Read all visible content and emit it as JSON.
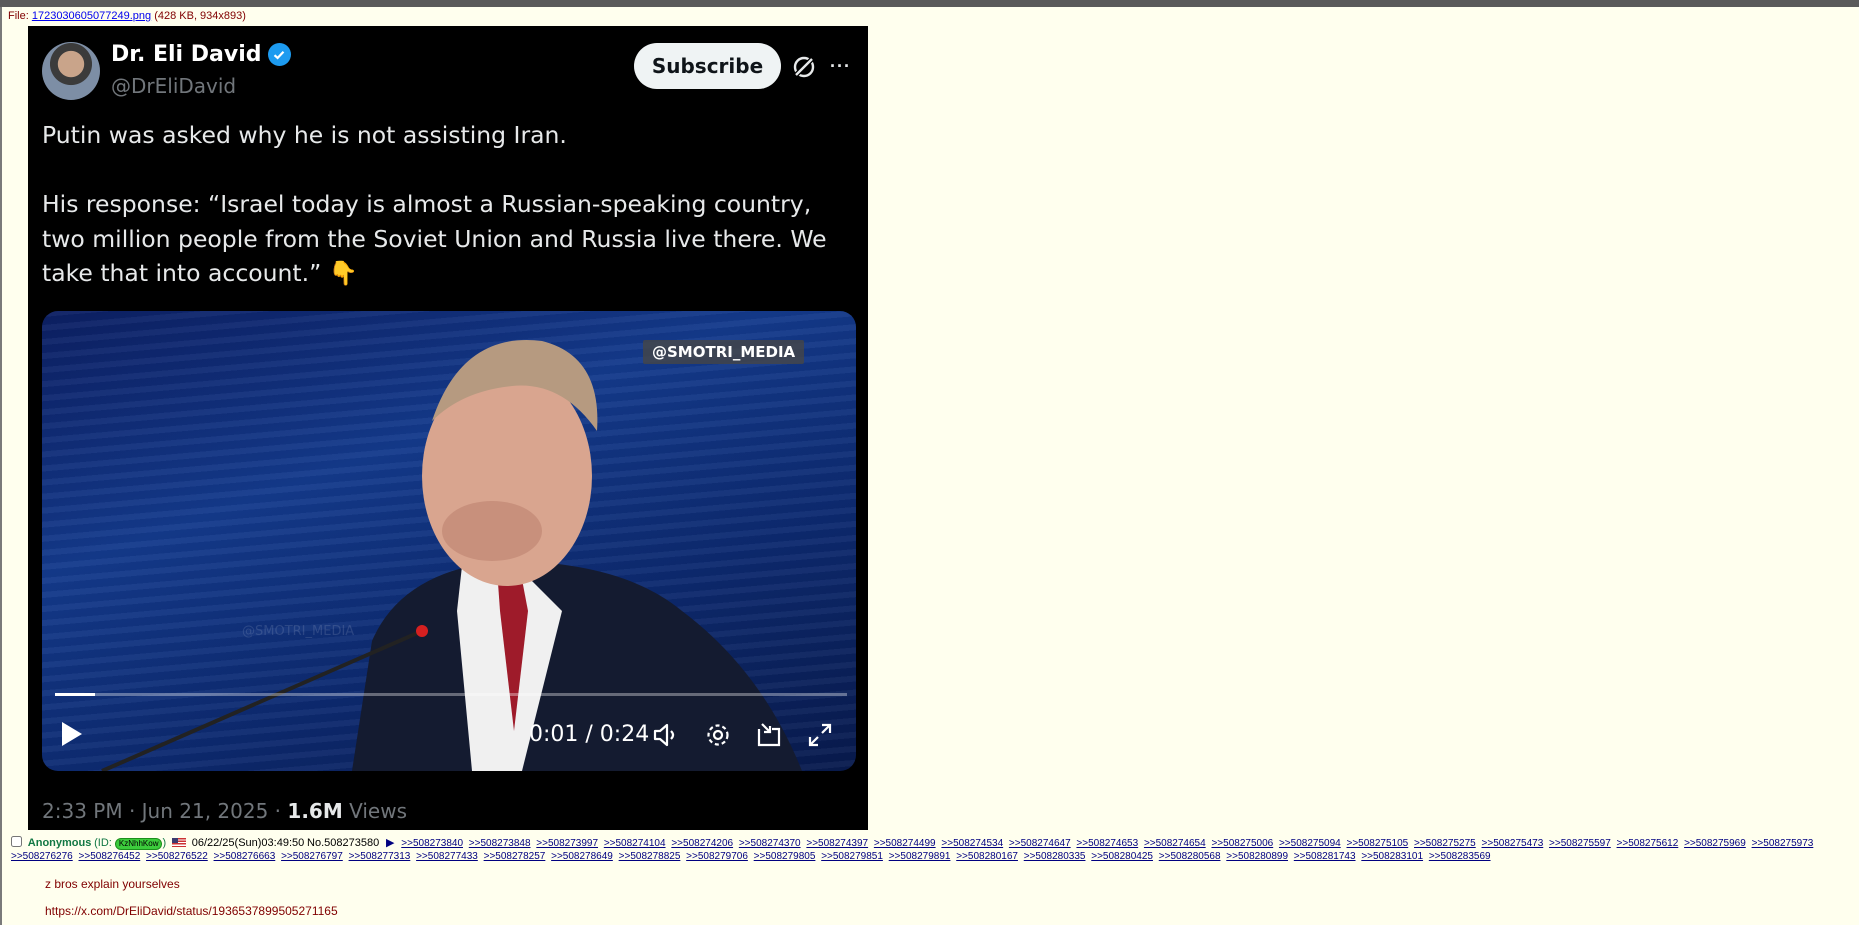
{
  "file": {
    "label": "File:",
    "filename": "1723030605077249.png",
    "info": "(428 KB, 934x893)"
  },
  "tweet": {
    "name": "Dr. Eli David",
    "handle": "@DrEliDavid",
    "subscribe_label": "Subscribe",
    "text": "Putin was asked why he is not assisting Iran.\n\nHis response: “Israel today is almost a Russian-speaking country, two million people from the Soviet Union and Russia live there. We take that into account.” 👇",
    "video_watermark": "@SMOTRI_MEDIA",
    "video_watermark_faint": "@SMOTRI_MEDIA",
    "video_time": "0:01 / 0:24",
    "video_progress": 0.05,
    "timestamp": "2:33 PM · Jun 21, 2025 · ",
    "views_count": "1.6M",
    "views_label": " Views",
    "colors": {
      "background": "#000000",
      "verified": "#1d9bf0",
      "muted": "#71767b"
    }
  },
  "post": {
    "name": "Anonymous",
    "id_prefix": "(ID: ",
    "id_value": "KzNhhKow",
    "id_suffix": ")",
    "datetime": "06/22/25(Sun)03:49:50",
    "number": "No.508273580",
    "arrow": "▶",
    "replies": [
      ">>508273840",
      ">>508273848",
      ">>508273997",
      ">>508274104",
      ">>508274206",
      ">>508274370",
      ">>508274397",
      ">>508274499",
      ">>508274534",
      ">>508274647",
      ">>508274653",
      ">>508274654",
      ">>508275006",
      ">>508275094",
      ">>508275105",
      ">>508275275",
      ">>508275473",
      ">>508275597",
      ">>508275612",
      ">>508275969",
      ">>508275973",
      ">>508276276",
      ">>508276452",
      ">>508276522",
      ">>508276663",
      ">>508276797",
      ">>508277313",
      ">>508277433",
      ">>508278257",
      ">>508278649",
      ">>508278825",
      ">>508279706",
      ">>508279805",
      ">>508279851",
      ">>508279891",
      ">>508280167",
      ">>508280335",
      ">>508280425",
      ">>508280568",
      ">>508280899",
      ">>508281743",
      ">>508283101",
      ">>508283569"
    ],
    "comment": "z bros explain yourselves",
    "link": "https://x.com/DrEliDavid/status/1936537899505271165"
  }
}
